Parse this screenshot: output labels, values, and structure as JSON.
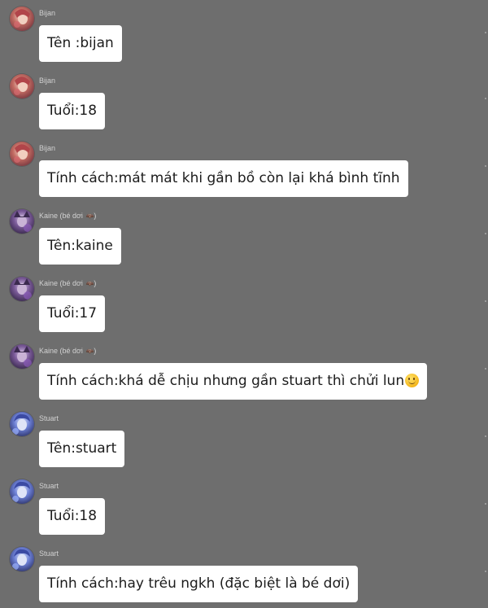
{
  "messages": [
    {
      "sender": "Bijan",
      "text": "Tên :bijan",
      "avatar": "bijan-avatar-icon"
    },
    {
      "sender": "Bijan",
      "text": "Tuổi:18",
      "avatar": "bijan-avatar-icon"
    },
    {
      "sender": "Bijan",
      "text": "Tính cách:mát mát khi gần bồ còn lại khá bình tĩnh",
      "avatar": "bijan-avatar-icon"
    },
    {
      "sender": "Kaine (bé dơi",
      "sender_suffix": ")",
      "text": "Tên:kaine",
      "avatar": "kaine-avatar-icon"
    },
    {
      "sender": "Kaine (bé dơi",
      "sender_suffix": ")",
      "text": "Tuổi:17",
      "avatar": "kaine-avatar-icon"
    },
    {
      "sender": "Kaine (bé dơi",
      "sender_suffix": ")",
      "text": "Tính cách:khá dễ chịu nhưng gần stuart thì chửi lun",
      "emoji": "slightly-smiling-face",
      "avatar": "kaine-avatar-icon"
    },
    {
      "sender": "Stuart",
      "text": "Tên:stuart",
      "avatar": "stuart-avatar-icon"
    },
    {
      "sender": "Stuart",
      "text": "Tuổi:18",
      "avatar": "stuart-avatar-icon"
    },
    {
      "sender": "Stuart",
      "text": "Tính cách:hay trêu ngkh (đặc biệt là bé dơi)",
      "avatar": "stuart-avatar-icon"
    }
  ],
  "colors": {
    "background": "#6e6e6e",
    "bubble": "#ffffff",
    "sender_text": "#d2d2d2",
    "message_text": "#1c1c1c"
  }
}
